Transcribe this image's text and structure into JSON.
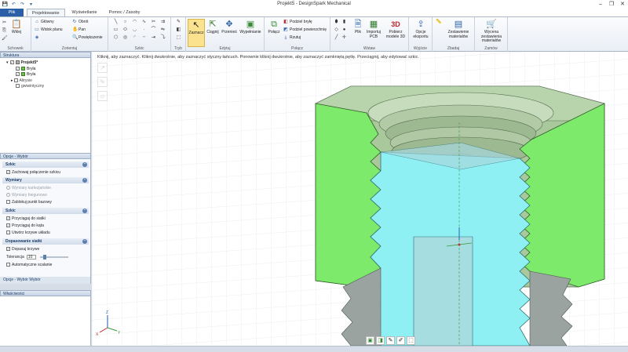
{
  "window": {
    "title": "Projekt5 - DesignSpark Mechanical",
    "controls": [
      "–",
      "❐",
      "✕"
    ]
  },
  "quick_access": [
    "💾",
    "↶",
    "↷",
    "▾"
  ],
  "tabs": [
    {
      "label": "Plik"
    },
    {
      "label": "Projektowanie"
    },
    {
      "label": "Wyświetlanie"
    },
    {
      "label": "Pomoc / Zasoby"
    }
  ],
  "ribbon": {
    "schowek": {
      "label": "Schowek",
      "paste": "Wklej"
    },
    "zorientuj": {
      "label": "Zorientuj",
      "glowny": "Główny",
      "widok_planu": "Widok planu",
      "obrot": "Obrót",
      "pan": "Pan",
      "powiekszenie": "Powiększenie"
    },
    "szkic": {
      "label": "Szkic"
    },
    "tryb": {
      "label": "Tryb"
    },
    "edytuj": {
      "label": "Edytuj",
      "zaznacz": "Zaznacz",
      "ciagnij": "Ciągnij",
      "przenies": "Przenieś",
      "wypelnianie": "Wypełnianie"
    },
    "polacz": {
      "label": "Połącz",
      "polacz_btn": "Połącz",
      "podziel_bryle": "Podziel bryłę",
      "podziel_powierzchnie": "Podziel powierzchnię",
      "rzutuj": "Rzutuj"
    },
    "wstaw": {
      "label": "Wstaw",
      "plik": "Plik",
      "importuj_pcb": "Importuj PCB",
      "pobierz_modele": "Pobierz modele 3D"
    },
    "wyjscie": {
      "label": "Wyjście",
      "opcje_eksportu": "Opcje eksportu"
    },
    "zbadaj": {
      "label": "Zbadaj",
      "zestawienie": "Zestawienie materiałów"
    },
    "zamow": {
      "label": "Zamów",
      "wycena": "Wycena zestawienia materiałów"
    }
  },
  "structure": {
    "header": "Struktura",
    "items": [
      {
        "label": "Projekt5*"
      },
      {
        "label": "Bryła"
      },
      {
        "label": "Bryła"
      },
      {
        "label": "Altrysie"
      },
      {
        "label": "gwiwintyczny"
      }
    ]
  },
  "options": {
    "header": "Opcje - Wybór",
    "sections": {
      "szkic1": "Szkic",
      "wymiary": "Wymiary",
      "szkic2": "Szkic",
      "dopasowanie": "Dopasowanie siatki"
    },
    "items": {
      "zachowaj": "Zachowaj połączenie szkicu",
      "kartezjanskie": "Wymiary kartezjańskie",
      "biegunowe": "Wymiary biegunowe",
      "zablokuj": "Zablokuj punkt bazowy",
      "przyciagaj_siatki": "Przyciągaj do siatki",
      "przyciagaj_kata": "Przyciągaj do kąta",
      "utworz": "Utwórz krzywe układu",
      "dopasuj": "Dopasuj krzywe",
      "tolerancja": "Tolerancja",
      "tolerancja_val": "10",
      "auto": "Automatyczne scalanie"
    },
    "tabs": "Opcje - Wybór   Wybór"
  },
  "properties": {
    "header": "Właściwości"
  },
  "viewport": {
    "hint": "Kliknij, aby zaznaczyć. Kliknij dwukrotnie, aby zaznaczyć styczny łańcuch. Ponownie kliknij dwukrotnie, aby zaznaczyć zamkniętą pętlę. Przeciągnij, aby edytować szkic.",
    "axis_labels": [
      "Z",
      "X",
      "Y"
    ]
  },
  "colors": {
    "green_face": "#7ee86a",
    "green_body": "#a8c99a",
    "cyan_face": "#8ff0f4",
    "accent": "#2b5fa8"
  }
}
